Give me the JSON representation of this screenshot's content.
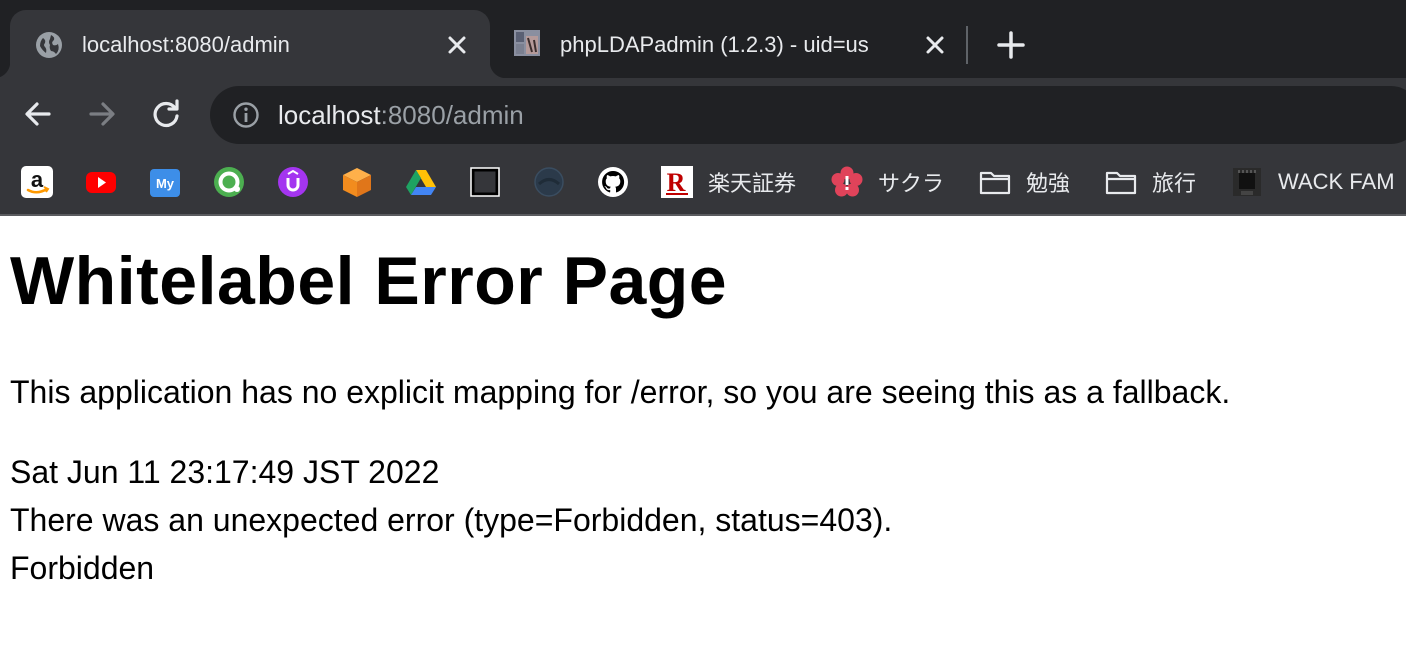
{
  "tabs": [
    {
      "title": "localhost:8080/admin",
      "active": true,
      "favicon": "globe-icon"
    },
    {
      "title": "phpLDAPadmin (1.2.3) - uid=us",
      "active": false,
      "favicon": "phpldapadmin-favicon"
    }
  ],
  "toolbar": {
    "url_host": "localhost",
    "url_path": ":8080/admin"
  },
  "bookmarks": [
    {
      "icon": "amazon-icon",
      "label": ""
    },
    {
      "icon": "youtube-icon",
      "label": ""
    },
    {
      "icon": "my-icon",
      "label": ""
    },
    {
      "icon": "green-circle-icon",
      "label": ""
    },
    {
      "icon": "udemy-icon",
      "label": ""
    },
    {
      "icon": "orange-box-icon",
      "label": ""
    },
    {
      "icon": "google-drive-icon",
      "label": ""
    },
    {
      "icon": "square-outline-icon",
      "label": ""
    },
    {
      "icon": "dark-circle-icon",
      "label": ""
    },
    {
      "icon": "github-icon",
      "label": ""
    },
    {
      "icon": "rakuten-icon",
      "label": "楽天証券"
    },
    {
      "icon": "sakura-icon",
      "label": "サクラ"
    },
    {
      "icon": "folder-icon",
      "label": "勉強"
    },
    {
      "icon": "folder-icon",
      "label": "旅行"
    },
    {
      "icon": "wack-icon",
      "label": "WACK FAM"
    }
  ],
  "page": {
    "title": "Whitelabel Error Page",
    "message": "This application has no explicit mapping for /error, so you are seeing this as a fallback.",
    "timestamp": "Sat Jun 11 23:17:49 JST 2022",
    "error": "There was an unexpected error (type=Forbidden, status=403).",
    "detail": "Forbidden"
  },
  "colors": {
    "frame": "#202124",
    "toolbar": "#35363a",
    "text_light": "#e8eaed",
    "text_dim": "#9aa0a6"
  }
}
